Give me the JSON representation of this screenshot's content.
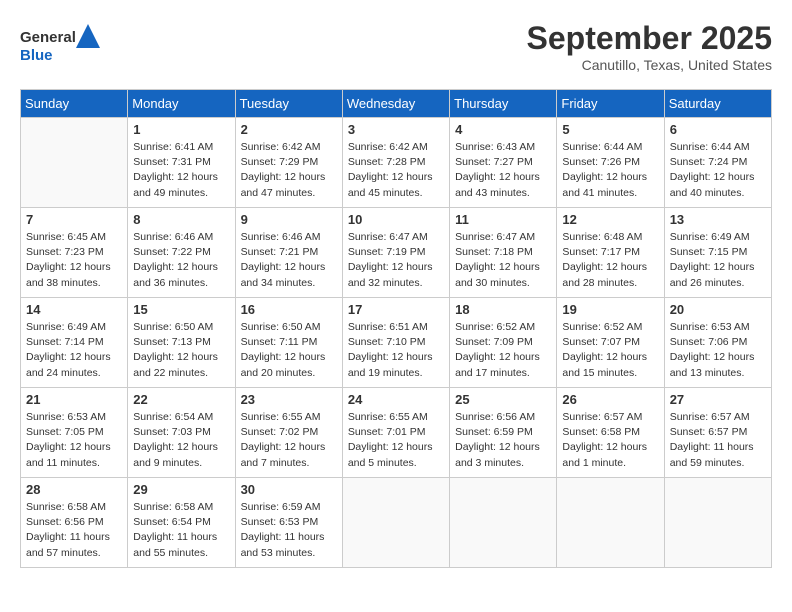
{
  "header": {
    "logo_line1": "General",
    "logo_line2": "Blue",
    "month": "September 2025",
    "location": "Canutillo, Texas, United States"
  },
  "days_of_week": [
    "Sunday",
    "Monday",
    "Tuesday",
    "Wednesday",
    "Thursday",
    "Friday",
    "Saturday"
  ],
  "weeks": [
    [
      {
        "day": "",
        "info": ""
      },
      {
        "day": "1",
        "info": "Sunrise: 6:41 AM\nSunset: 7:31 PM\nDaylight: 12 hours\nand 49 minutes."
      },
      {
        "day": "2",
        "info": "Sunrise: 6:42 AM\nSunset: 7:29 PM\nDaylight: 12 hours\nand 47 minutes."
      },
      {
        "day": "3",
        "info": "Sunrise: 6:42 AM\nSunset: 7:28 PM\nDaylight: 12 hours\nand 45 minutes."
      },
      {
        "day": "4",
        "info": "Sunrise: 6:43 AM\nSunset: 7:27 PM\nDaylight: 12 hours\nand 43 minutes."
      },
      {
        "day": "5",
        "info": "Sunrise: 6:44 AM\nSunset: 7:26 PM\nDaylight: 12 hours\nand 41 minutes."
      },
      {
        "day": "6",
        "info": "Sunrise: 6:44 AM\nSunset: 7:24 PM\nDaylight: 12 hours\nand 40 minutes."
      }
    ],
    [
      {
        "day": "7",
        "info": "Sunrise: 6:45 AM\nSunset: 7:23 PM\nDaylight: 12 hours\nand 38 minutes."
      },
      {
        "day": "8",
        "info": "Sunrise: 6:46 AM\nSunset: 7:22 PM\nDaylight: 12 hours\nand 36 minutes."
      },
      {
        "day": "9",
        "info": "Sunrise: 6:46 AM\nSunset: 7:21 PM\nDaylight: 12 hours\nand 34 minutes."
      },
      {
        "day": "10",
        "info": "Sunrise: 6:47 AM\nSunset: 7:19 PM\nDaylight: 12 hours\nand 32 minutes."
      },
      {
        "day": "11",
        "info": "Sunrise: 6:47 AM\nSunset: 7:18 PM\nDaylight: 12 hours\nand 30 minutes."
      },
      {
        "day": "12",
        "info": "Sunrise: 6:48 AM\nSunset: 7:17 PM\nDaylight: 12 hours\nand 28 minutes."
      },
      {
        "day": "13",
        "info": "Sunrise: 6:49 AM\nSunset: 7:15 PM\nDaylight: 12 hours\nand 26 minutes."
      }
    ],
    [
      {
        "day": "14",
        "info": "Sunrise: 6:49 AM\nSunset: 7:14 PM\nDaylight: 12 hours\nand 24 minutes."
      },
      {
        "day": "15",
        "info": "Sunrise: 6:50 AM\nSunset: 7:13 PM\nDaylight: 12 hours\nand 22 minutes."
      },
      {
        "day": "16",
        "info": "Sunrise: 6:50 AM\nSunset: 7:11 PM\nDaylight: 12 hours\nand 20 minutes."
      },
      {
        "day": "17",
        "info": "Sunrise: 6:51 AM\nSunset: 7:10 PM\nDaylight: 12 hours\nand 19 minutes."
      },
      {
        "day": "18",
        "info": "Sunrise: 6:52 AM\nSunset: 7:09 PM\nDaylight: 12 hours\nand 17 minutes."
      },
      {
        "day": "19",
        "info": "Sunrise: 6:52 AM\nSunset: 7:07 PM\nDaylight: 12 hours\nand 15 minutes."
      },
      {
        "day": "20",
        "info": "Sunrise: 6:53 AM\nSunset: 7:06 PM\nDaylight: 12 hours\nand 13 minutes."
      }
    ],
    [
      {
        "day": "21",
        "info": "Sunrise: 6:53 AM\nSunset: 7:05 PM\nDaylight: 12 hours\nand 11 minutes."
      },
      {
        "day": "22",
        "info": "Sunrise: 6:54 AM\nSunset: 7:03 PM\nDaylight: 12 hours\nand 9 minutes."
      },
      {
        "day": "23",
        "info": "Sunrise: 6:55 AM\nSunset: 7:02 PM\nDaylight: 12 hours\nand 7 minutes."
      },
      {
        "day": "24",
        "info": "Sunrise: 6:55 AM\nSunset: 7:01 PM\nDaylight: 12 hours\nand 5 minutes."
      },
      {
        "day": "25",
        "info": "Sunrise: 6:56 AM\nSunset: 6:59 PM\nDaylight: 12 hours\nand 3 minutes."
      },
      {
        "day": "26",
        "info": "Sunrise: 6:57 AM\nSunset: 6:58 PM\nDaylight: 12 hours\nand 1 minute."
      },
      {
        "day": "27",
        "info": "Sunrise: 6:57 AM\nSunset: 6:57 PM\nDaylight: 11 hours\nand 59 minutes."
      }
    ],
    [
      {
        "day": "28",
        "info": "Sunrise: 6:58 AM\nSunset: 6:56 PM\nDaylight: 11 hours\nand 57 minutes."
      },
      {
        "day": "29",
        "info": "Sunrise: 6:58 AM\nSunset: 6:54 PM\nDaylight: 11 hours\nand 55 minutes."
      },
      {
        "day": "30",
        "info": "Sunrise: 6:59 AM\nSunset: 6:53 PM\nDaylight: 11 hours\nand 53 minutes."
      },
      {
        "day": "",
        "info": ""
      },
      {
        "day": "",
        "info": ""
      },
      {
        "day": "",
        "info": ""
      },
      {
        "day": "",
        "info": ""
      }
    ]
  ]
}
